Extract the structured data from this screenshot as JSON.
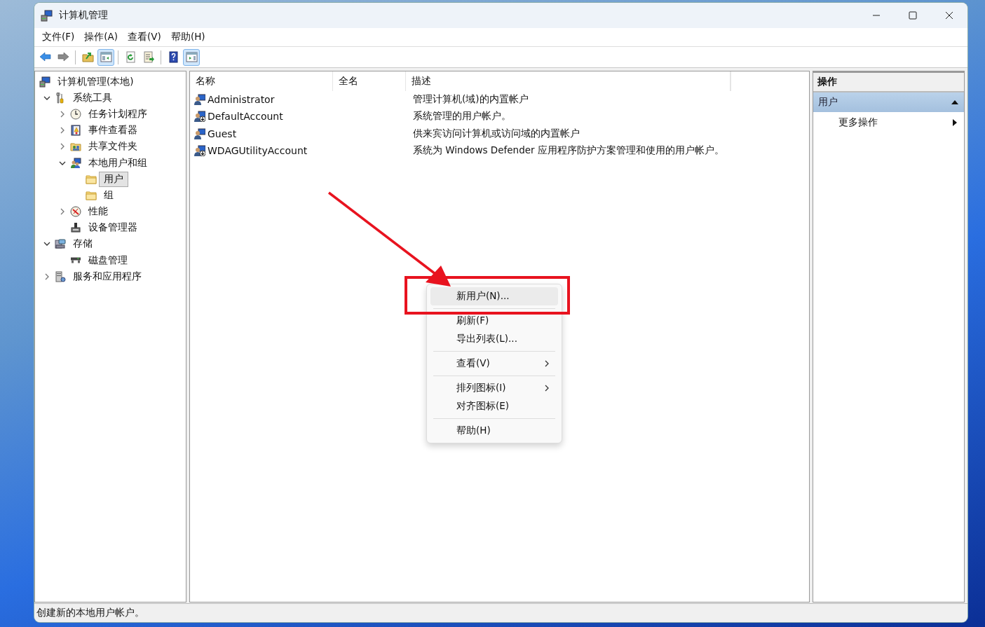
{
  "window": {
    "title": "计算机管理"
  },
  "menu_bar": [
    "文件(F)",
    "操作(A)",
    "查看(V)",
    "帮助(H)"
  ],
  "toolbar": [
    {
      "kind": "back",
      "pressed": false
    },
    {
      "kind": "forward",
      "pressed": false
    },
    {
      "kind": "separator"
    },
    {
      "kind": "up",
      "pressed": false
    },
    {
      "kind": "tree-toggle",
      "pressed": true
    },
    {
      "kind": "separator"
    },
    {
      "kind": "refresh",
      "pressed": false
    },
    {
      "kind": "export",
      "pressed": false
    },
    {
      "kind": "separator"
    },
    {
      "kind": "help",
      "pressed": false
    },
    {
      "kind": "action-toggle",
      "pressed": true
    }
  ],
  "tree": [
    {
      "label": "计算机管理(本地)",
      "kind": "computer",
      "selected": false,
      "children": [
        {
          "label": "系统工具",
          "kind": "tools",
          "expanded": true,
          "selected": false,
          "children": [
            {
              "label": "任务计划程序",
              "kind": "clock",
              "expanded": false,
              "selected": false
            },
            {
              "label": "事件查看器",
              "kind": "log",
              "expanded": false,
              "selected": false
            },
            {
              "label": "共享文件夹",
              "kind": "share",
              "expanded": false,
              "selected": false
            },
            {
              "label": "本地用户和组",
              "kind": "users",
              "expanded": true,
              "selected": false,
              "children": [
                {
                  "label": "用户",
                  "kind": "folder",
                  "selected": true
                },
                {
                  "label": "组",
                  "kind": "folder",
                  "selected": false
                }
              ]
            },
            {
              "label": "性能",
              "kind": "gauge",
              "expanded": false,
              "selected": false
            },
            {
              "label": "设备管理器",
              "kind": "device",
              "selected": false
            }
          ]
        },
        {
          "label": "存储",
          "kind": "storage",
          "expanded": true,
          "selected": false,
          "children": [
            {
              "label": "磁盘管理",
              "kind": "disk",
              "selected": false
            }
          ]
        },
        {
          "label": "服务和应用程序",
          "kind": "services",
          "expanded": false,
          "selected": false
        }
      ]
    }
  ],
  "list": {
    "columns": [
      {
        "label": "名称"
      },
      {
        "label": "全名"
      },
      {
        "label": "描述"
      }
    ],
    "rows": [
      {
        "name": "Administrator",
        "description": "管理计算机(域)的内置帐户",
        "disabled": false
      },
      {
        "name": "DefaultAccount",
        "description": "系统管理的用户帐户。",
        "disabled": true
      },
      {
        "name": "Guest",
        "description": "供来宾访问计算机或访问域的内置帐户",
        "disabled": false
      },
      {
        "name": "WDAGUtilityAccount",
        "description": "系统为 Windows Defender 应用程序防护方案管理和使用的用户帐户。",
        "disabled": true
      }
    ]
  },
  "context_menu": {
    "items": [
      {
        "kind": "item",
        "label": "新用户(N)...",
        "selected": true,
        "submenu": false
      },
      {
        "kind": "separator"
      },
      {
        "kind": "item",
        "label": "刷新(F)",
        "selected": false,
        "submenu": false
      },
      {
        "kind": "item",
        "label": "导出列表(L)...",
        "selected": false,
        "submenu": false
      },
      {
        "kind": "separator"
      },
      {
        "kind": "item",
        "label": "查看(V)",
        "selected": false,
        "submenu": true
      },
      {
        "kind": "separator"
      },
      {
        "kind": "item",
        "label": "排列图标(I)",
        "selected": false,
        "submenu": true
      },
      {
        "kind": "item",
        "label": "对齐图标(E)",
        "selected": false,
        "submenu": false
      },
      {
        "kind": "separator"
      },
      {
        "kind": "item",
        "label": "帮助(H)",
        "selected": false,
        "submenu": false
      }
    ]
  },
  "actions": {
    "header": "操作",
    "section": {
      "label": "用户",
      "expanded": true,
      "items": [
        {
          "label": "更多操作",
          "submenu": true
        }
      ]
    }
  },
  "status_bar": "创建新的本地用户帐户。"
}
